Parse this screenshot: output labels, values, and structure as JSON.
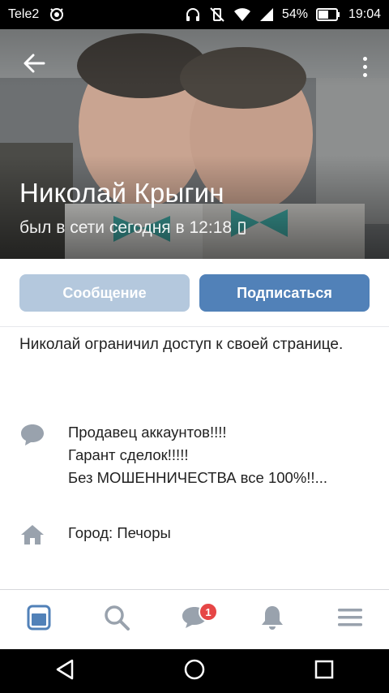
{
  "status_bar": {
    "carrier": "Tele2",
    "battery": "54%",
    "time": "19:04"
  },
  "profile": {
    "name": "Николай Крыгин",
    "last_seen": "был в сети сегодня в 12:18"
  },
  "actions": {
    "message_label": "Сообщение",
    "subscribe_label": "Подписаться"
  },
  "restricted_text": "Николай ограничил доступ к своей странице.",
  "bio": {
    "icon": "speech-bubble-icon",
    "lines": [
      "Продавец аккаунтов!!!!",
      "Гарант сделок!!!!!",
      "Без МОШЕННИЧЕСТВА все 100%!!..."
    ]
  },
  "city": {
    "icon": "home-icon",
    "text": "Город: Печоры"
  },
  "tabs": {
    "items": [
      "news-icon",
      "search-icon",
      "messages-icon",
      "notifications-icon",
      "menu-icon"
    ],
    "messages_badge": "1"
  },
  "colors": {
    "primary": "#5181b8",
    "primary_disabled": "#b4c8dd",
    "badge": "#e64646",
    "icon_gray": "#99a2ad"
  }
}
